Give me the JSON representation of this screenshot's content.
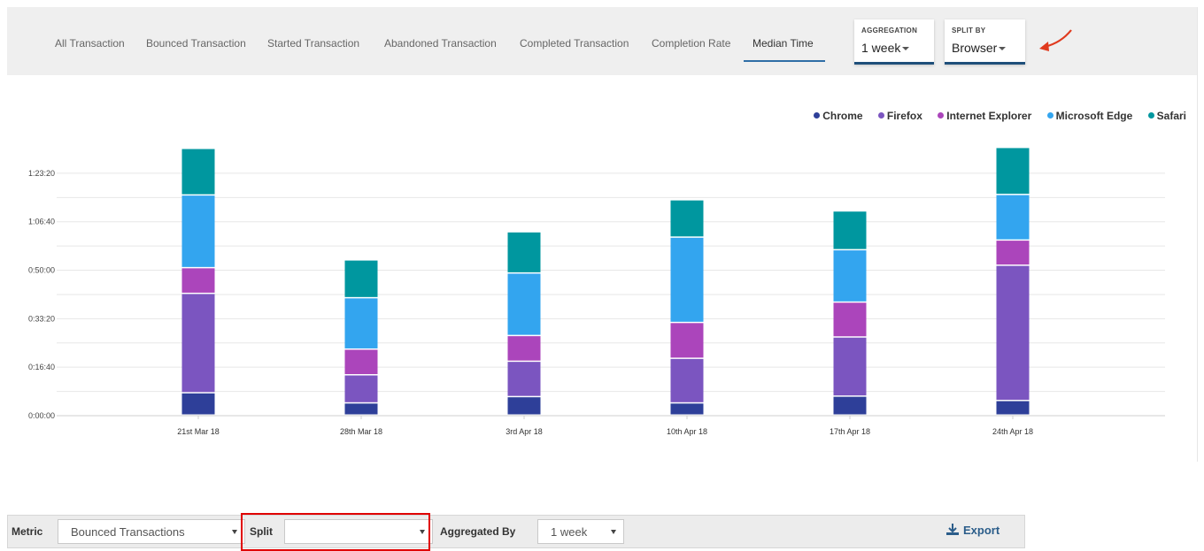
{
  "tabs": [
    {
      "label": "All Transaction",
      "active": false
    },
    {
      "label": "Bounced Transaction",
      "active": false
    },
    {
      "label": "Started Transaction",
      "active": false
    },
    {
      "label": "Abandoned Transaction",
      "active": false
    },
    {
      "label": "Completed Transaction",
      "active": false
    },
    {
      "label": "Completion Rate",
      "active": false
    },
    {
      "label": "Median Time",
      "active": true
    }
  ],
  "aggregation": {
    "caption": "AGGREGATION",
    "value": "1 week"
  },
  "split_by": {
    "caption": "SPLIT BY",
    "value": "Browser"
  },
  "toolbar": {
    "metric_label": "Metric",
    "metric_value": "Bounced Transactions",
    "split_label": "Split",
    "split_value": "",
    "aggregated_label": "Aggregated By",
    "aggregated_value": "1 week",
    "export_label": "Export"
  },
  "colors": {
    "Chrome": "#2e3f99",
    "Firefox": "#7b55c0",
    "Internet Explorer": "#ab45bb",
    "Microsoft Edge": "#33a5ef",
    "Safari": "#00979f",
    "accent": "#2f6ea6",
    "arrow": "#e03a1e",
    "highlight": "#e00000"
  },
  "chart_data": {
    "type": "bar",
    "stacked": true,
    "categories": [
      "21st Mar 18",
      "28th Mar 18",
      "3rd Apr 18",
      "10th Apr 18",
      "17th Apr 18",
      "24th Apr 18"
    ],
    "y_unit": "seconds",
    "ylim": [
      0,
      5400
    ],
    "y_ticks": [
      0,
      1000,
      2000,
      3000,
      4000,
      5000
    ],
    "y_tick_labels": [
      "0:00:00",
      "0:16:40",
      "0:33:20",
      "0:50:00",
      "1:06:40",
      "1:23:20"
    ],
    "grid": true,
    "legend_position": "top-right",
    "series": [
      {
        "name": "Chrome",
        "values": [
          460,
          250,
          380,
          250,
          390,
          300
        ]
      },
      {
        "name": "Firefox",
        "values": [
          2050,
          580,
          730,
          920,
          1220,
          2790
        ]
      },
      {
        "name": "Internet Explorer",
        "values": [
          530,
          530,
          530,
          740,
          720,
          520
        ]
      },
      {
        "name": "Microsoft Edge",
        "values": [
          1500,
          1060,
          1290,
          1760,
          1080,
          940
        ]
      },
      {
        "name": "Safari",
        "values": [
          960,
          780,
          850,
          770,
          800,
          970
        ]
      }
    ]
  }
}
